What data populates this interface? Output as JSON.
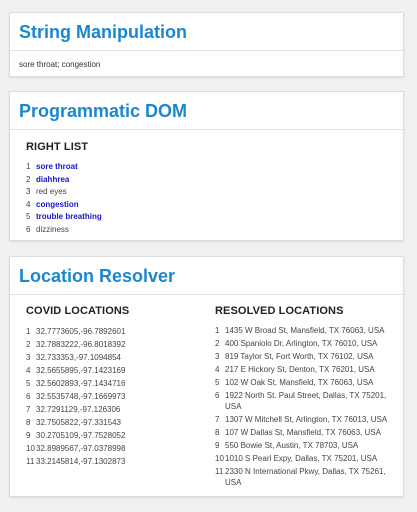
{
  "string_manipulation": {
    "title": "String Manipulation",
    "text": "sore throat; congestion"
  },
  "programmatic_dom": {
    "title": "Programmatic DOM",
    "list_heading": "RIGHT LIST",
    "items": [
      {
        "num": "1",
        "label": "sore throat",
        "highlighted": true
      },
      {
        "num": "2",
        "label": "diahhrea",
        "highlighted": true
      },
      {
        "num": "3",
        "label": "red eyes",
        "highlighted": false
      },
      {
        "num": "4",
        "label": "congestion",
        "highlighted": true
      },
      {
        "num": "5",
        "label": "trouble breathing",
        "highlighted": true
      },
      {
        "num": "6",
        "label": "dizziness",
        "highlighted": false
      }
    ],
    "highlight_color": "#1a14c9"
  },
  "location_resolver": {
    "title": "Location Resolver",
    "covid_heading": "COVID LOCATIONS",
    "resolved_heading": "RESOLVED LOCATIONS",
    "covid_locations": [
      {
        "num": "1",
        "value": "32.7773605,-96.7892601"
      },
      {
        "num": "2",
        "value": "32.7883222,-96.8018392"
      },
      {
        "num": "3",
        "value": "32.733353,-97.1094854"
      },
      {
        "num": "4",
        "value": "32.5655895,-97.1423169"
      },
      {
        "num": "5",
        "value": "32.5602893,-97.1434716"
      },
      {
        "num": "6",
        "value": "32.5535748,-97.1669973"
      },
      {
        "num": "7",
        "value": "32.7291129,-97.126306"
      },
      {
        "num": "8",
        "value": "32.7505822,-97.331543"
      },
      {
        "num": "9",
        "value": "30.2705109,-97.7528052"
      },
      {
        "num": "10",
        "value": "32.8989567,-97.0378998"
      },
      {
        "num": "11",
        "value": "33.2145814,-97.1302873"
      }
    ],
    "resolved_locations": [
      {
        "num": "1",
        "value": "1435 W Broad St, Mansfield, TX 76063, USA"
      },
      {
        "num": "2",
        "value": "400 Spaniolo Dr, Arlington, TX 76010, USA"
      },
      {
        "num": "3",
        "value": "819 Taylor St, Fort Worth, TX 76102, USA"
      },
      {
        "num": "4",
        "value": "217 E Hickory St, Denton, TX 76201, USA"
      },
      {
        "num": "5",
        "value": "102 W Oak St, Mansfield, TX 76063, USA"
      },
      {
        "num": "6",
        "value": "1922 North St. Paul Street, Dallas, TX 75201, USA"
      },
      {
        "num": "7",
        "value": "1307 W Mitchell St, Arlington, TX 76013, USA"
      },
      {
        "num": "8",
        "value": "107 W Dallas St, Mansfield, TX 76063, USA"
      },
      {
        "num": "9",
        "value": "550 Bowie St, Austin, TX 78703, USA"
      },
      {
        "num": "10",
        "value": "1010 S Pearl Expy, Dallas, TX 75201, USA"
      },
      {
        "num": "11",
        "value": "2330 N International Pkwy, Dallas, TX 75261, USA"
      }
    ]
  },
  "colors": {
    "accent": "#1b87d0",
    "background": "#f0f0f0"
  }
}
